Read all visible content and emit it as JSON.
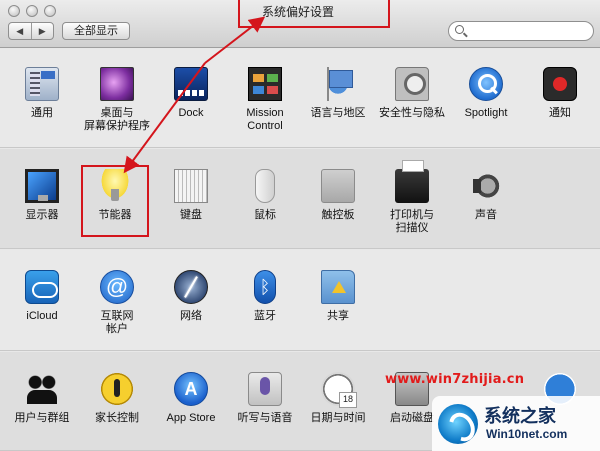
{
  "window": {
    "title": "系统偏好设置",
    "nav_back": "◀",
    "nav_forward": "▶",
    "show_all": "全部显示",
    "search_placeholder": ""
  },
  "row1": [
    {
      "label": "通用",
      "icon": "general-icon"
    },
    {
      "label": "桌面与\n屏幕保护程序",
      "icon": "desktop-screensaver-icon"
    },
    {
      "label": "Dock",
      "icon": "dock-icon"
    },
    {
      "label": "Mission\nControl",
      "icon": "mission-control-icon"
    },
    {
      "label": "语言与地区",
      "icon": "language-region-icon"
    },
    {
      "label": "安全性与隐私",
      "icon": "security-privacy-icon"
    },
    {
      "label": "Spotlight",
      "icon": "spotlight-icon"
    },
    {
      "label": "通知",
      "icon": "notifications-icon"
    }
  ],
  "row2": [
    {
      "label": "显示器",
      "icon": "displays-icon"
    },
    {
      "label": "节能器",
      "icon": "energy-saver-icon"
    },
    {
      "label": "键盘",
      "icon": "keyboard-icon"
    },
    {
      "label": "鼠标",
      "icon": "mouse-icon"
    },
    {
      "label": "触控板",
      "icon": "trackpad-icon"
    },
    {
      "label": "打印机与\n扫描仪",
      "icon": "printers-scanners-icon"
    },
    {
      "label": "声音",
      "icon": "sound-icon"
    }
  ],
  "row3": [
    {
      "label": "iCloud",
      "icon": "icloud-icon"
    },
    {
      "label": "互联网\n帐户",
      "icon": "internet-accounts-icon",
      "glyph": "@"
    },
    {
      "label": "网络",
      "icon": "network-icon"
    },
    {
      "label": "蓝牙",
      "icon": "bluetooth-icon",
      "glyph": "ᛒ"
    },
    {
      "label": "共享",
      "icon": "sharing-icon"
    }
  ],
  "row4": [
    {
      "label": "用户与群组",
      "icon": "users-groups-icon"
    },
    {
      "label": "家长控制",
      "icon": "parental-controls-icon"
    },
    {
      "label": "App Store",
      "icon": "app-store-icon",
      "glyph": "A"
    },
    {
      "label": "听写与语音",
      "icon": "dictation-speech-icon"
    },
    {
      "label": "日期与时间",
      "icon": "date-time-icon"
    },
    {
      "label": "启动磁盘",
      "icon": "startup-disk-icon"
    },
    {
      "label": "",
      "icon": "accessibility-icon"
    }
  ],
  "watermark": {
    "url": "www.win7zhijia.cn",
    "title": "系统之家",
    "subtitle": "Win10net.com"
  },
  "colors": {
    "annotation_red": "#d4151c"
  }
}
